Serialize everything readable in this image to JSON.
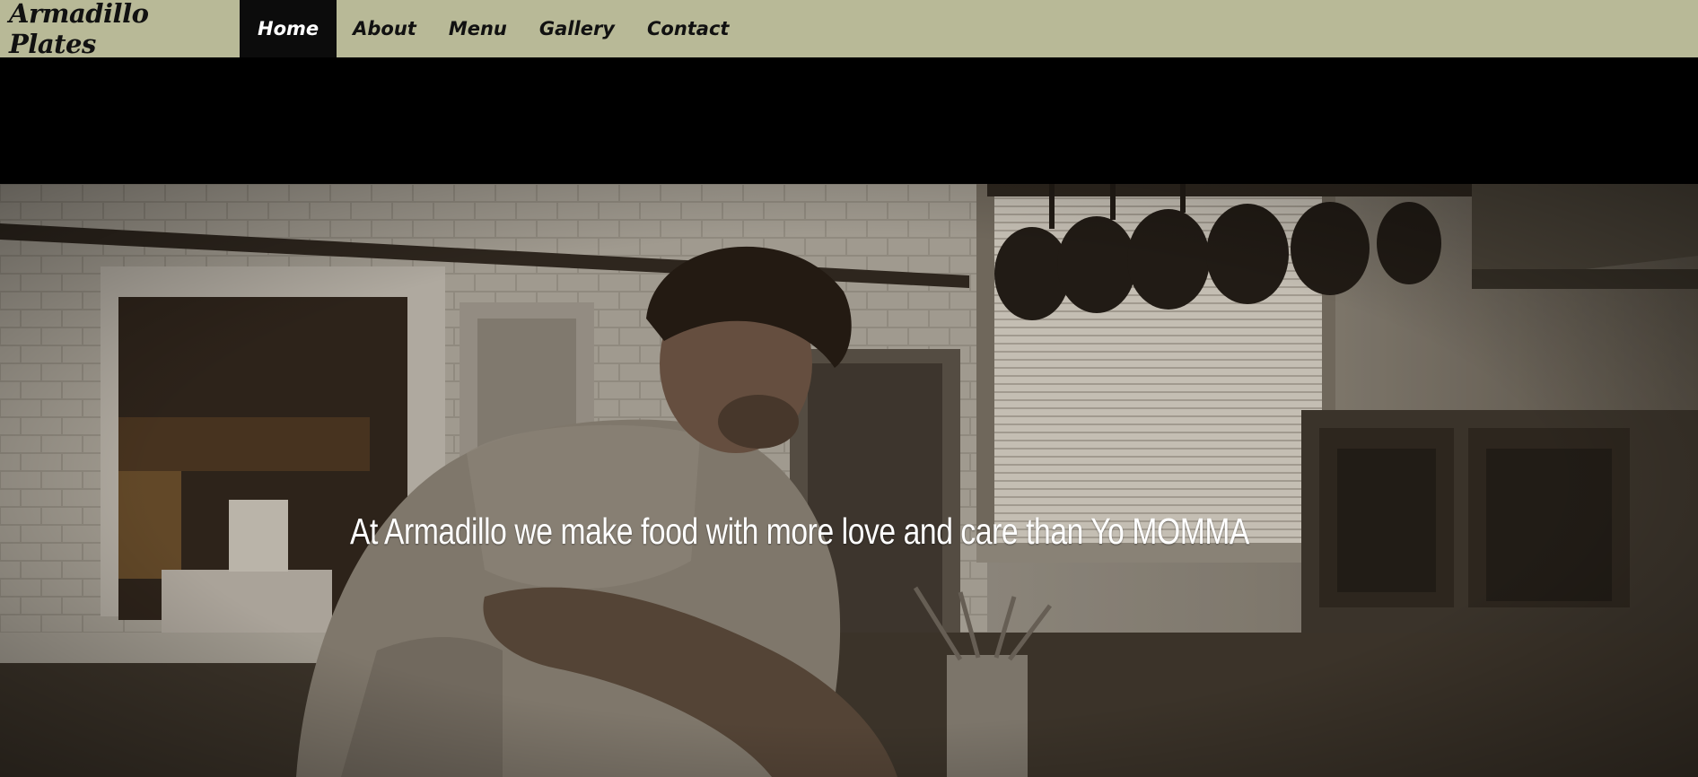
{
  "brand": {
    "name": "Armadillo Plates"
  },
  "nav": {
    "items": [
      {
        "label": "Home",
        "active": true
      },
      {
        "label": "About",
        "active": false
      },
      {
        "label": "Menu",
        "active": false
      },
      {
        "label": "Gallery",
        "active": false
      },
      {
        "label": "Contact",
        "active": false
      }
    ]
  },
  "hero": {
    "caption": "At Armadillo we make food with more love and care than Yo MOMMA"
  },
  "colors": {
    "navbar_bg": "#b8b997",
    "active_tab_bg": "#0c0c0c",
    "band_bg": "#000000"
  }
}
